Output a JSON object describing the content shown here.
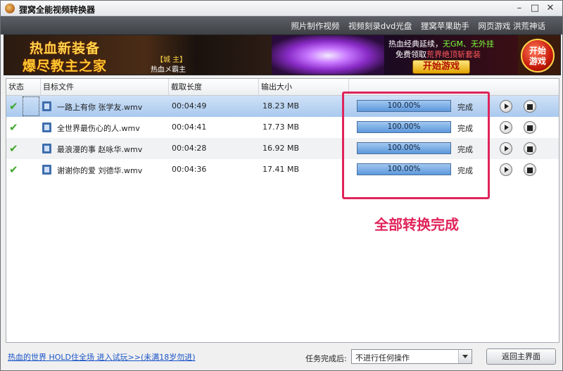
{
  "window": {
    "title": "狸窝全能视频转换器",
    "min_glyph": "–",
    "max_glyph": "□",
    "close_glyph": "✕"
  },
  "top_menu": [
    {
      "label": "照片制作视频"
    },
    {
      "label": "视频刻录dvd光盘"
    },
    {
      "label": "狸窝苹果助手"
    },
    {
      "label": "网页游戏 洪荒神话"
    }
  ],
  "banner": {
    "line1": "热血新装备",
    "line2": "爆尽教主之家",
    "tag": "【城 主】",
    "subtitle": "热血メ霸主",
    "right_line1_a": "热血经典延续，",
    "right_line1_b": "无GM、无外挂",
    "right_line2_a": "免费领取",
    "right_line2_b": "荒界绝顶斩套装",
    "play_label": "开始游戏",
    "start_label": "开始\n游戏"
  },
  "table": {
    "headers": [
      "状态",
      "目标文件",
      "截取长度",
      "输出大小",
      ""
    ],
    "rows": [
      {
        "file": "一路上有你 张学友.wmv",
        "length": "00:04:49",
        "size": "18.23 MB",
        "progress": 100,
        "progress_text": "100.00%",
        "status": "完成",
        "selected": true
      },
      {
        "file": "全世界最伤心的人.wmv",
        "length": "00:04:41",
        "size": "17.73 MB",
        "progress": 100,
        "progress_text": "100.00%",
        "status": "完成",
        "selected": false
      },
      {
        "file": "最浪漫的事 赵咏华.wmv",
        "length": "00:04:28",
        "size": "16.92 MB",
        "progress": 100,
        "progress_text": "100.00%",
        "status": "完成",
        "selected": false
      },
      {
        "file": "谢谢你的爱 刘德华.wmv",
        "length": "00:04:36",
        "size": "17.41 MB",
        "progress": 100,
        "progress_text": "100.00%",
        "status": "完成",
        "selected": false
      }
    ]
  },
  "annotation": {
    "text": "全部转换完成",
    "color": "#e0245a"
  },
  "footer": {
    "ad_link": "热血的世界 HOLD住全场 进入试玩>>(未满18岁勿进)",
    "after_label": "任务完成后:",
    "after_value": "不进行任何操作",
    "home_button": "返回主界面"
  },
  "colors": {
    "progress_fill": "#5c98dc",
    "check": "#3fa82a",
    "link": "#1a55c8"
  }
}
